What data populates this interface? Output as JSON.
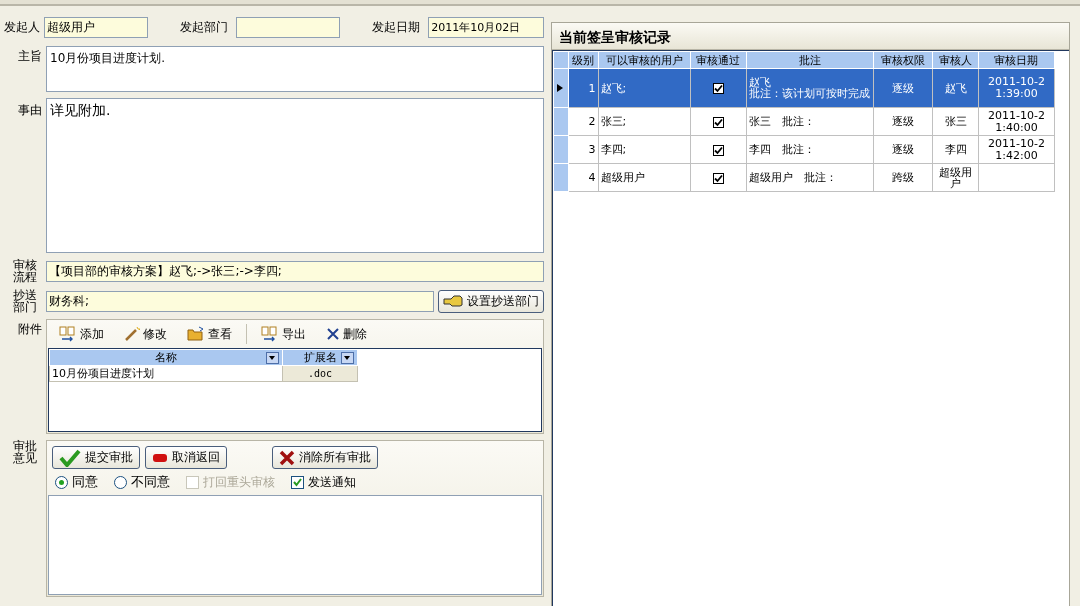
{
  "form": {
    "initiator_label": "发起人",
    "initiator": "超级用户",
    "department_label": "发起部门",
    "date_label": "发起日期",
    "date": "2011年10月02日",
    "subject_label": "主旨",
    "subject": "10月份项目进度计划.",
    "reason_label": "事由",
    "reason": "详见附加.",
    "flow_label": "审核流程",
    "flow": "【项目部的审核方案】赵飞;->张三;->李四;",
    "cc_label": "抄送部门",
    "cc": "财务科;",
    "cc_button": "设置抄送部门"
  },
  "attachments": {
    "label": "附件",
    "toolbar": [
      {
        "kind": "add",
        "label": "添加"
      },
      {
        "kind": "edit",
        "label": "修改"
      },
      {
        "kind": "view",
        "label": "查看"
      },
      {
        "kind": "export",
        "label": "导出"
      },
      {
        "kind": "delete",
        "label": "删除"
      }
    ],
    "columns": [
      "名称",
      "扩展名"
    ],
    "rows": [
      [
        "10月份项目进度计划",
        ".doc"
      ]
    ]
  },
  "approval": {
    "label": "审批意见",
    "buttons": [
      {
        "kind": "submit",
        "label": "提交审批"
      },
      {
        "kind": "cancel",
        "label": "取消返回"
      },
      {
        "kind": "clear",
        "label": "消除所有审批"
      }
    ],
    "options": [
      {
        "kind": "radio",
        "label": "同意",
        "selected": true,
        "disabled": false
      },
      {
        "kind": "radio",
        "label": "不同意",
        "selected": false,
        "disabled": false
      },
      {
        "kind": "checkbox",
        "label": "打回重头审核",
        "checked": false,
        "disabled": true
      },
      {
        "kind": "checkbox",
        "label": "发送通知",
        "checked": true,
        "disabled": false
      }
    ]
  },
  "records": {
    "title": "当前签呈审核记录",
    "columns": [
      "级别",
      "可以审核的用户",
      "审核通过",
      "批注",
      "审核权限",
      "审核人",
      "审核日期"
    ],
    "rows": [
      {
        "selected": true,
        "level": "1",
        "user": "赵飞;",
        "passed": true,
        "note": [
          "赵飞",
          "批注：该计划可按时完成"
        ],
        "authority": "逐级",
        "reviewer": "赵飞",
        "date": "2011-10-2\n1:39:00"
      },
      {
        "selected": false,
        "level": "2",
        "user": "张三;",
        "passed": true,
        "note": [
          "张三　批注："
        ],
        "authority": "逐级",
        "reviewer": "张三",
        "date": "2011-10-2\n1:40:00"
      },
      {
        "selected": false,
        "level": "3",
        "user": "李四;",
        "passed": true,
        "note": [
          "李四　批注："
        ],
        "authority": "逐级",
        "reviewer": "李四",
        "date": "2011-10-2\n1:42:00"
      },
      {
        "selected": false,
        "level": "4",
        "user": "超级用户",
        "passed": true,
        "note": [
          "超级用户　批注："
        ],
        "authority": "跨级",
        "reviewer": "超级用户",
        "date": ""
      }
    ]
  }
}
